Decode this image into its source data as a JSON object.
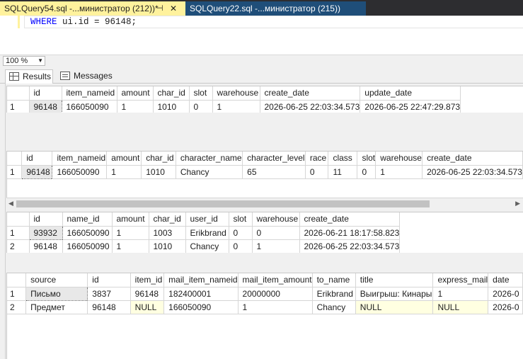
{
  "doc_tabs": [
    {
      "label": "SQLQuery54.sql -...министратор (212))*",
      "pin": "⊣",
      "close": "✕"
    },
    {
      "label": "SQLQuery22.sql -...министратор (215))"
    }
  ],
  "editor": {
    "kw1": "WHERE",
    "rest": " ui.id = 96148;"
  },
  "zoom": "100 %",
  "result_tabs": {
    "results": "Results",
    "messages": "Messages"
  },
  "grid1": {
    "columns": [
      "id",
      "item_nameid",
      "amount",
      "char_id",
      "slot",
      "warehouse",
      "create_date",
      "update_date"
    ],
    "rows": [
      {
        "rn": "1",
        "cells": [
          "96148",
          "166050090",
          "1",
          "1010",
          "0",
          "1",
          "2026-06-25 22:03:34.573",
          "2026-06-25 22:47:29.873"
        ]
      }
    ]
  },
  "grid2": {
    "columns": [
      "id",
      "item_nameid",
      "amount",
      "char_id",
      "character_name",
      "character_level",
      "race",
      "class",
      "slot",
      "warehouse",
      "create_date"
    ],
    "rows": [
      {
        "rn": "1",
        "cells": [
          "96148",
          "166050090",
          "1",
          "1010",
          "Chancy",
          "65",
          "0",
          "11",
          "0",
          "1",
          "2026-06-25 22:03:34.573"
        ]
      }
    ]
  },
  "grid3": {
    "columns": [
      "id",
      "name_id",
      "amount",
      "char_id",
      "user_id",
      "slot",
      "warehouse",
      "create_date"
    ],
    "rows": [
      {
        "rn": "1",
        "cells": [
          "93932",
          "166050090",
          "1",
          "1003",
          "Erikbrand",
          "0",
          "0",
          "2026-06-21 18:17:58.823"
        ]
      },
      {
        "rn": "2",
        "cells": [
          "96148",
          "166050090",
          "1",
          "1010",
          "Chancy",
          "0",
          "1",
          "2026-06-25 22:03:34.573"
        ]
      }
    ]
  },
  "grid4": {
    "columns": [
      "source",
      "id",
      "item_id",
      "mail_item_nameid",
      "mail_item_amount",
      "to_name",
      "title",
      "express_mail",
      "date"
    ],
    "rows": [
      {
        "rn": "1",
        "cells": [
          "Письмо",
          "3837",
          "96148",
          "182400001",
          "20000000",
          "Erikbrand",
          "Выигрыш: Кинары",
          "1",
          "2026-0"
        ]
      },
      {
        "rn": "2",
        "cells": [
          "Предмет",
          "96148",
          "NULL",
          "166050090",
          "1",
          "Chancy",
          "NULL",
          "NULL",
          "2026-0"
        ]
      }
    ]
  }
}
